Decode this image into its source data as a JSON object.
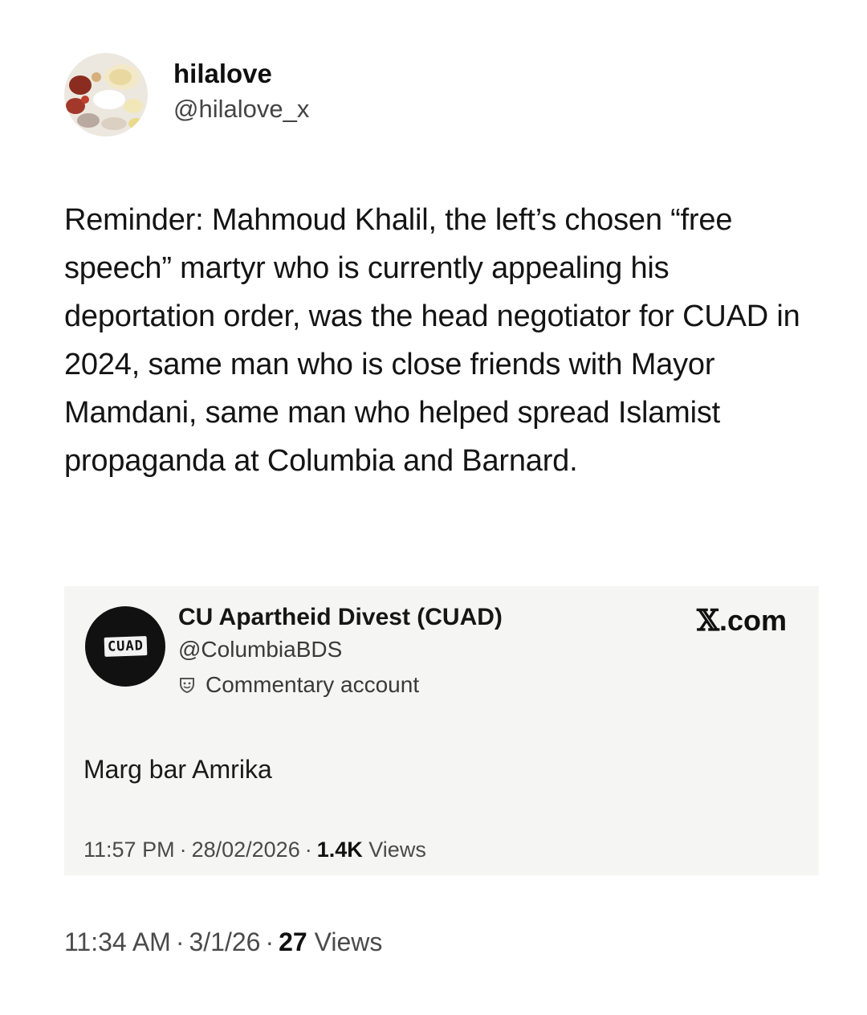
{
  "author": {
    "display_name": "hilalove",
    "handle": "@hilalove_x"
  },
  "tweet": {
    "text": "Reminder: Mahmoud Khalil, the left’s chosen “free speech” martyr who is currently appealing his deportation order, was the head negotiator for CUAD in 2024, same man who is close friends with Mayor Mamdani, same man who helped spread Islamist propaganda at Columbia and Barnard.",
    "time": "11:34 AM",
    "date": "3/1/26",
    "views_count": "27",
    "views_label": "Views"
  },
  "quote": {
    "avatar_text": "CUAD",
    "display_name": "CU Apartheid Divest (CUAD)",
    "handle": "@ColumbiaBDS",
    "badge_label": "Commentary account",
    "badge_icon": "theater-masks-icon",
    "source_glyph": "𝕏",
    "source_suffix": ".com",
    "text": "Marg bar Amrika",
    "time": "11:57 PM",
    "date": "28/02/2026",
    "views_count": "1.4K",
    "views_label": "Views"
  },
  "separator": "·",
  "colors": {
    "background": "#ffffff",
    "quote_background": "#f5f5f4",
    "text_primary": "#111111",
    "text_secondary": "#4a4a4a"
  }
}
